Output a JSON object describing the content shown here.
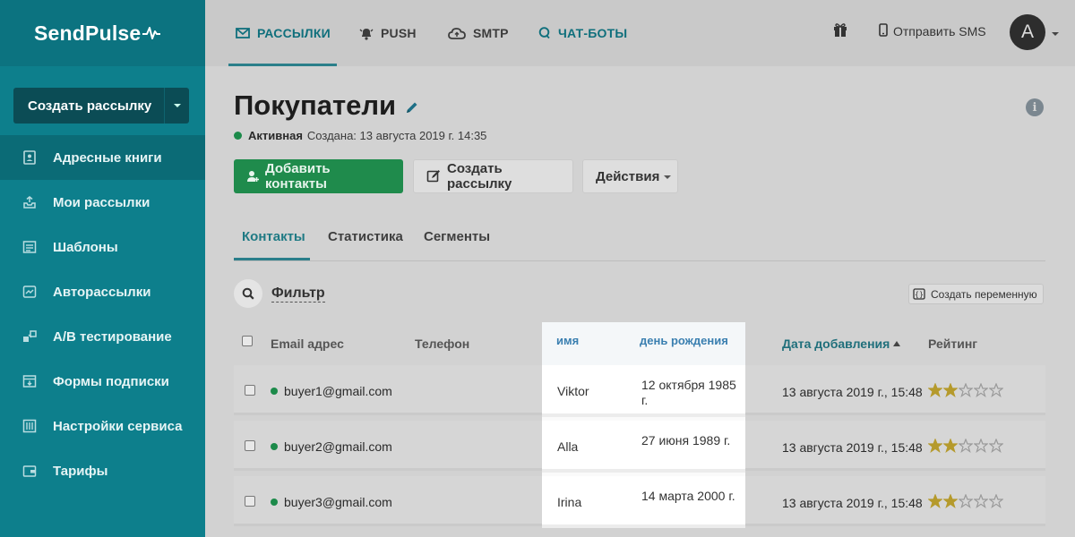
{
  "logo": {
    "text": "SendPulse"
  },
  "sidebar": {
    "create_label": "Создать рассылку",
    "items": [
      {
        "label": "Адресные книги",
        "icon": "address-book-icon",
        "active": true
      },
      {
        "label": "Мои рассылки",
        "icon": "outbox-icon"
      },
      {
        "label": "Шаблоны",
        "icon": "templates-icon"
      },
      {
        "label": "Авторассылки",
        "icon": "automation-icon"
      },
      {
        "label": "A/B тестирование",
        "icon": "ab-test-icon"
      },
      {
        "label": "Формы подписки",
        "icon": "forms-icon"
      },
      {
        "label": "Настройки сервиса",
        "icon": "settings-icon"
      },
      {
        "label": "Тарифы",
        "icon": "wallet-icon"
      }
    ]
  },
  "topnav": {
    "tabs": [
      {
        "label": "РАССЫЛКИ",
        "icon": "mail-icon",
        "active": true
      },
      {
        "label": "PUSH",
        "icon": "bell-icon"
      },
      {
        "label": "SMTP",
        "icon": "cloud-icon"
      },
      {
        "label": "ЧАТ-БОТЫ",
        "icon": "chat-icon"
      }
    ],
    "sms_label": "Отправить SMS",
    "avatar_letter": "A"
  },
  "page": {
    "title": "Покупатели",
    "status": "Активная",
    "created": "Создана: 13 августа 2019 г. 14:35",
    "add_contacts": "Добавить контакты",
    "create_campaign": "Создать рассылку",
    "actions": "Действия"
  },
  "tabs": [
    "Контакты",
    "Статистика",
    "Сегменты"
  ],
  "filter": {
    "label": "Фильтр",
    "create_variable": "Создать переменную"
  },
  "table": {
    "headers": {
      "email": "Email адрес",
      "phone": "Телефон",
      "name": "имя",
      "birthday": "день рождения",
      "date_added": "Дата добавления",
      "rating": "Рейтинг"
    },
    "rows": [
      {
        "email": "buyer1@gmail.com",
        "name": "Viktor",
        "birthday": "12 октября 1985 г.",
        "date_added": "13 августа 2019 г., 15:48",
        "rating": 2
      },
      {
        "email": "buyer2@gmail.com",
        "name": "Alla",
        "birthday": "27 июня 1989 г.",
        "date_added": "13 августа 2019 г., 15:48",
        "rating": 2
      },
      {
        "email": "buyer3@gmail.com",
        "name": "Irina",
        "birthday": "14 марта 2000 г.",
        "date_added": "13 августа 2019 г., 15:48",
        "rating": 2
      }
    ]
  },
  "colors": {
    "sidebar": "#0d7f8c",
    "accent": "#1f8b4c",
    "link": "#176e6b"
  }
}
